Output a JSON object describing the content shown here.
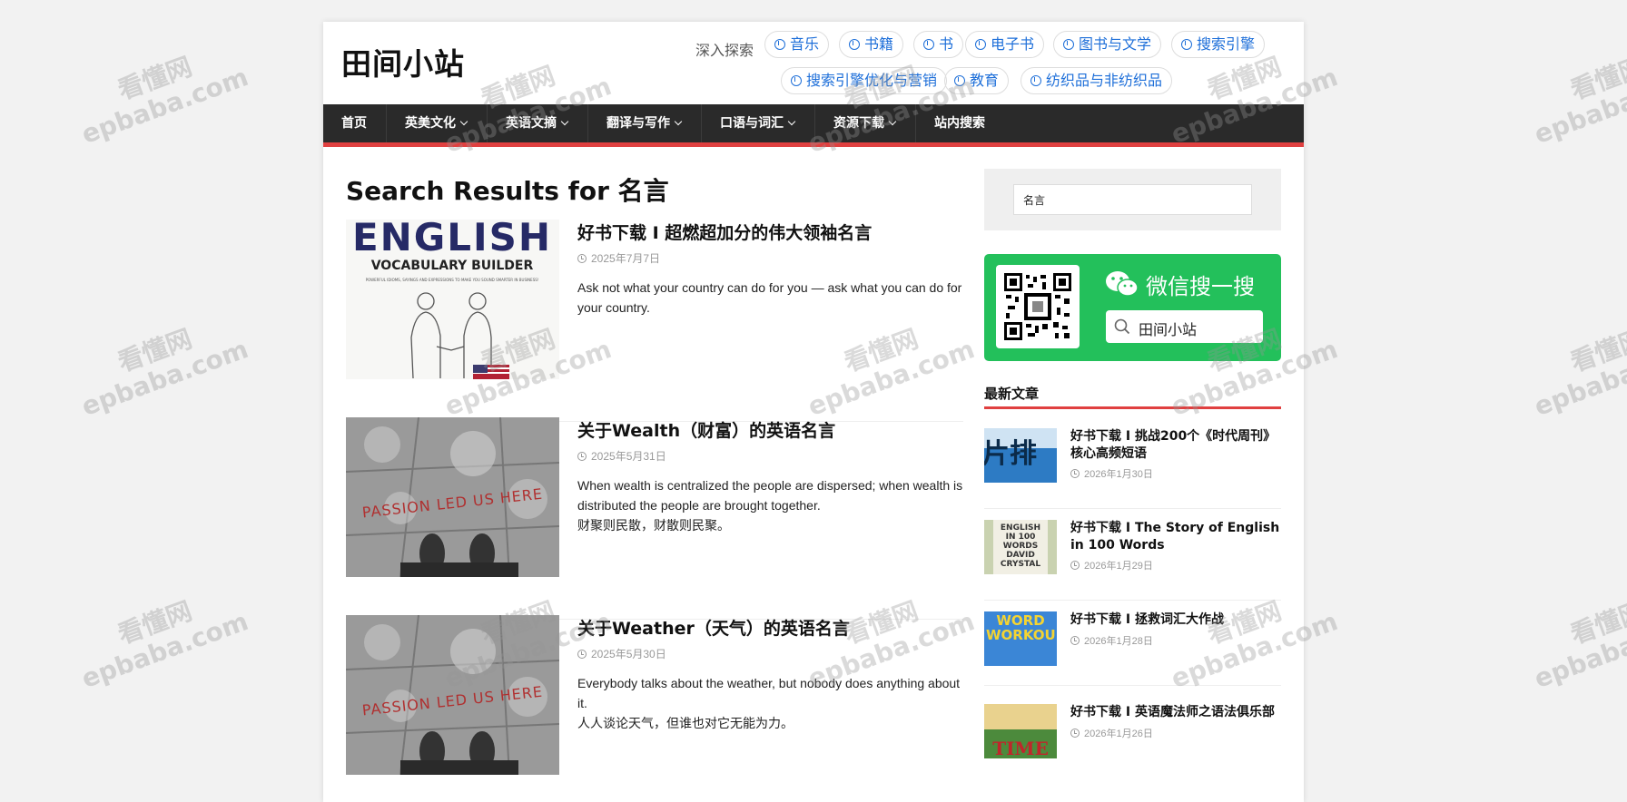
{
  "site": {
    "title": "田间小站"
  },
  "explore": {
    "label": "深入探索",
    "tags": [
      "音乐",
      "书籍",
      "书",
      "电子书",
      "图书与文学",
      "搜索引擎",
      "搜索引擎优化与营销",
      "教育",
      "纺织品与非纺织品"
    ]
  },
  "nav": {
    "items": [
      {
        "label": "首页",
        "dropdown": false
      },
      {
        "label": "英美文化",
        "dropdown": true
      },
      {
        "label": "英语文摘",
        "dropdown": true
      },
      {
        "label": "翻译与写作",
        "dropdown": true
      },
      {
        "label": "口语与词汇",
        "dropdown": true
      },
      {
        "label": "资源下载",
        "dropdown": true
      },
      {
        "label": "站内搜索",
        "dropdown": false
      }
    ]
  },
  "results": {
    "title": "Search Results for 名言"
  },
  "posts": [
    {
      "title": "好书下载 I 超燃超加分的伟大领袖名言",
      "date": "2025年7月7日",
      "excerpt": [
        "Ask not what your country can do for you — ask what you can do for your country."
      ],
      "thumb_text": {
        "big": "ENGLISH",
        "sub": "VOCABULARY BUILDER",
        "tiny": "POWERFUL IDIOMS, SAYINGS AND EXPRESSIONS TO MAKE YOU SOUND SMARTER IN BUSINESS!"
      }
    },
    {
      "title": "关于Wealth（财富）的英语名言",
      "date": "2025年5月31日",
      "excerpt": [
        "When wealth is centralized the people are dispersed; when wealth is distributed the people are brought together.",
        "财聚则民散，财散则民聚。"
      ],
      "thumb_text": {
        "big": "PASSION LED US HERE"
      }
    },
    {
      "title": "关于Weather（天气）的英语名言",
      "date": "2025年5月30日",
      "excerpt": [
        "Everybody talks about the weather, but nobody does anything about it.",
        "人人谈论天气，但谁也对它无能为力。"
      ],
      "thumb_text": {
        "big": "PASSION LED US HERE"
      }
    }
  ],
  "sidebar": {
    "search_value": "名言",
    "wechat": {
      "title": "微信搜一搜",
      "search_text": "田间小站"
    },
    "latest_heading": "最新文章",
    "latest": [
      {
        "title": "好书下载 I 挑战200个《时代周刊》核心高频短语",
        "date": "2026年1月30日",
        "thumb_text": "片排"
      },
      {
        "title": "好书下载 I The Story of English in 100 Words",
        "date": "2026年1月29日",
        "thumb_text": "ENGLISH IN 100 WORDS DAVID CRYSTAL"
      },
      {
        "title": "好书下载 I 拯救词汇大作战",
        "date": "2026年1月28日",
        "thumb_text": "WORD WORKOUT"
      },
      {
        "title": "好书下载 I 英语魔法师之语法俱乐部",
        "date": "2026年1月26日",
        "thumb_text": "TIME"
      }
    ]
  },
  "watermark": {
    "line1": "看懂网",
    "line2": "epbaba.com"
  },
  "colors": {
    "accent": "#e04040",
    "link": "#1e6fd9",
    "nav_bg": "#2a2a2a",
    "wechat_green": "#23c05b"
  }
}
